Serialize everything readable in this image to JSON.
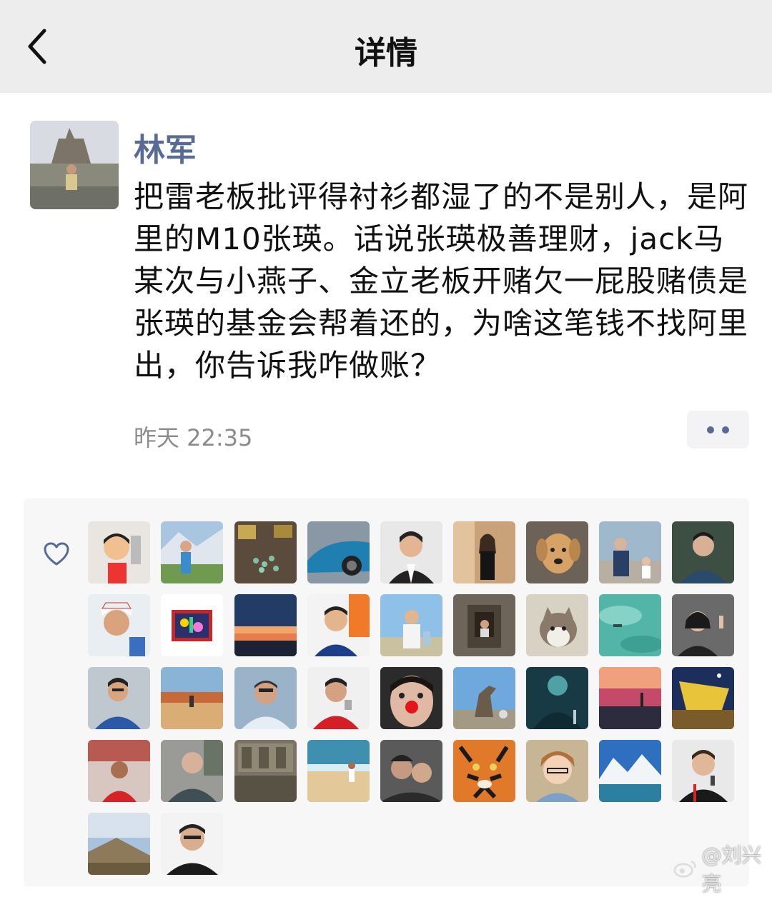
{
  "header": {
    "title": "详情",
    "back_icon": "chevron-left-icon"
  },
  "post": {
    "author": "林军",
    "text": "把雷老板批评得衬衫都湿了的不是别人，是阿里的M10张瑛。话说张瑛极善理财，jack马某次与小燕子、金立老板开赌欠一屁股赌债是张瑛的基金会帮着还的，为啥这笔钱不找阿里出，你告诉我咋做账？",
    "timestamp": "昨天 22:35",
    "more_icon": "more-dots-icon"
  },
  "likes": {
    "icon": "heart-outline-icon",
    "count": 38
  },
  "watermark": {
    "text": "@刘兴亮"
  },
  "colors": {
    "link": "#576b95",
    "header_bg": "#ededed",
    "panel_bg": "#f7f7f7"
  }
}
